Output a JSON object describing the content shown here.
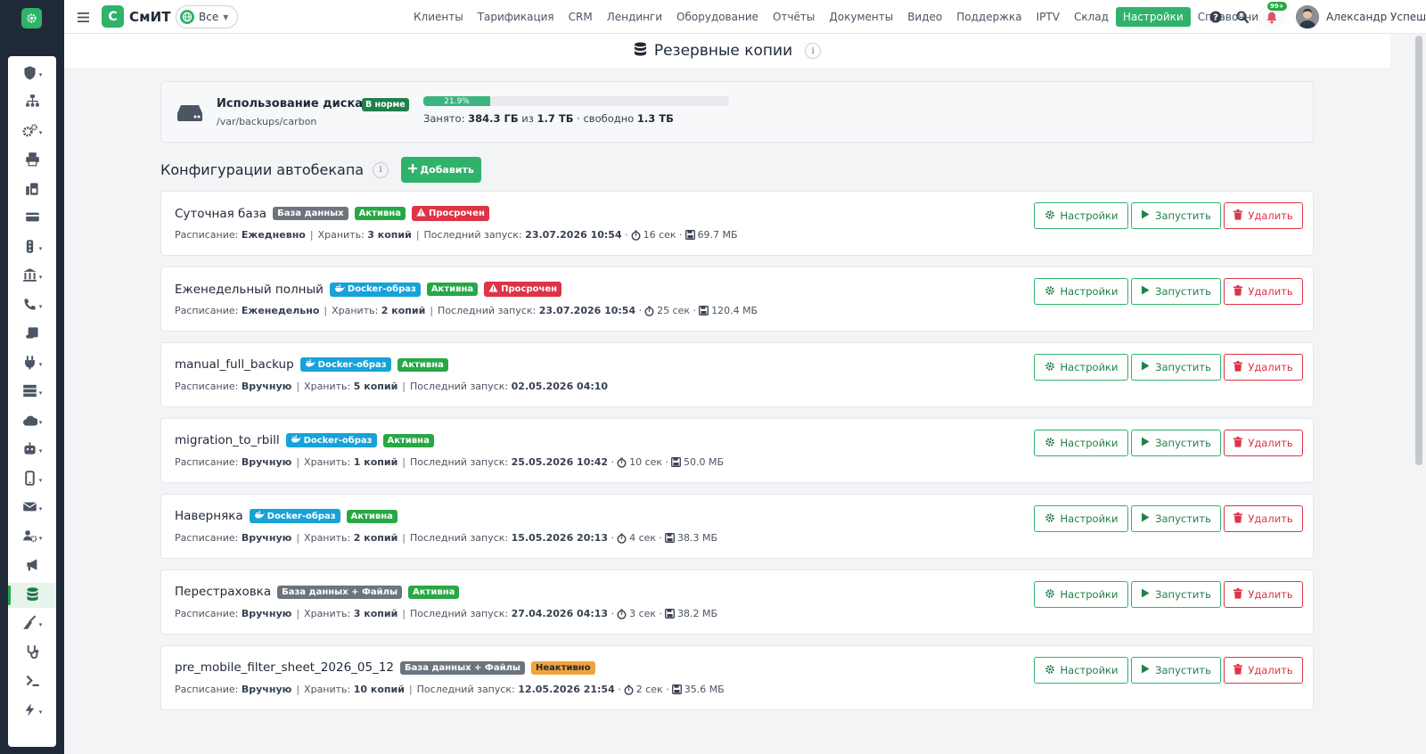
{
  "brand": {
    "name": "СмИТ",
    "logo_letter": "С"
  },
  "scope": {
    "label": "Все"
  },
  "nav": [
    {
      "label": "Клиенты"
    },
    {
      "label": "Тарификация"
    },
    {
      "label": "CRM"
    },
    {
      "label": "Лендинги"
    },
    {
      "label": "Оборудование"
    },
    {
      "label": "Отчёты"
    },
    {
      "label": "Документы"
    },
    {
      "label": "Видео"
    },
    {
      "label": "Поддержка"
    },
    {
      "label": "IPTV"
    },
    {
      "label": "Склад"
    },
    {
      "label": "Настройки",
      "active": true
    },
    {
      "label": "Справочники"
    }
  ],
  "notifications": {
    "badge": "99+"
  },
  "user": {
    "name": "Александр Успешный"
  },
  "page": {
    "title": "Резервные копии",
    "info": "i"
  },
  "sidebar_icons": [
    "shield-icon",
    "sitemap-icon",
    "cogs-icon",
    "print-icon",
    "fax-icon",
    "credit-card-icon",
    "traffic-light-icon",
    "bank-icon",
    "call-icon",
    "scroll-icon",
    "plug-icon",
    "server-icon",
    "cloud-icon",
    "robot-icon",
    "mobile-icon",
    "envelope-icon",
    "users-cog-icon",
    "megaphone-icon",
    "database-icon",
    "broom-icon",
    "stethoscope-icon",
    "terminal-icon",
    "bolt-icon"
  ],
  "disk": {
    "title": "Использование диска",
    "status": "В норме",
    "path": "/var/backups/carbon",
    "percent_label": "21.9%",
    "used_fraction": 0.219,
    "used_prefix": "Занято:",
    "used": "384.3 ГБ",
    "of_word": "из",
    "total": "1.7 ТБ",
    "free_prefix": "· свободно",
    "free": "1.3 ТБ"
  },
  "section": {
    "title": "Конфигурации автобекапа",
    "info": "i",
    "add_label": "Добавить"
  },
  "labels": {
    "schedule": "Расписание:",
    "keep": "Хранить:",
    "last_run": "Последний запуск:",
    "settings_btn": "Настройки",
    "run_btn": "Запустить",
    "delete_btn": "Удалить"
  },
  "colors": {
    "accent": "#2fb36b",
    "danger": "#dc3545",
    "docker": "#17a2d8",
    "warning": "#f0a33c"
  },
  "backups": [
    {
      "name": "Суточная база",
      "type": "База данных",
      "type_color": "gray",
      "status": "Активна",
      "status_color": "green",
      "alert": "Просрочен",
      "schedule": "Ежедневно",
      "keep": "3 копий",
      "last_run": "23.07.2026 10:54",
      "duration": "16 сек",
      "size": "69.7 МБ"
    },
    {
      "name": "Еженедельный полный",
      "type": "Docker-образ",
      "type_color": "blue",
      "status": "Активна",
      "status_color": "green",
      "alert": "Просрочен",
      "schedule": "Еженедельно",
      "keep": "2 копий",
      "last_run": "23.07.2026 10:54",
      "duration": "25 сек",
      "size": "120.4 МБ"
    },
    {
      "name": "manual_full_backup",
      "type": "Docker-образ",
      "type_color": "blue",
      "status": "Активна",
      "status_color": "green",
      "alert": "",
      "schedule": "Вручную",
      "keep": "5 копий",
      "last_run": "02.05.2026 04:10",
      "duration": "",
      "size": ""
    },
    {
      "name": "migration_to_rbill",
      "type": "Docker-образ",
      "type_color": "blue",
      "status": "Активна",
      "status_color": "green",
      "alert": "",
      "schedule": "Вручную",
      "keep": "1 копий",
      "last_run": "25.05.2026 10:42",
      "duration": "10 сек",
      "size": "50.0 МБ"
    },
    {
      "name": "Наверняка",
      "type": "Docker-образ",
      "type_color": "blue",
      "status": "Активна",
      "status_color": "green",
      "alert": "",
      "schedule": "Вручную",
      "keep": "2 копий",
      "last_run": "15.05.2026 20:13",
      "duration": "4 сек",
      "size": "38.3 МБ"
    },
    {
      "name": "Перестраховка",
      "type": "База данных + Файлы",
      "type_color": "gray",
      "status": "Активна",
      "status_color": "green",
      "alert": "",
      "schedule": "Вручную",
      "keep": "3 копий",
      "last_run": "27.04.2026 04:13",
      "duration": "3 сек",
      "size": "38.2 МБ"
    },
    {
      "name": "pre_mobile_filter_sheet_2026_05_12",
      "type": "База данных + Файлы",
      "type_color": "gray",
      "status": "Неактивно",
      "status_color": "orange",
      "alert": "",
      "schedule": "Вручную",
      "keep": "10 копий",
      "last_run": "12.05.2026 21:54",
      "duration": "2 сек",
      "size": "35.6 МБ"
    }
  ]
}
